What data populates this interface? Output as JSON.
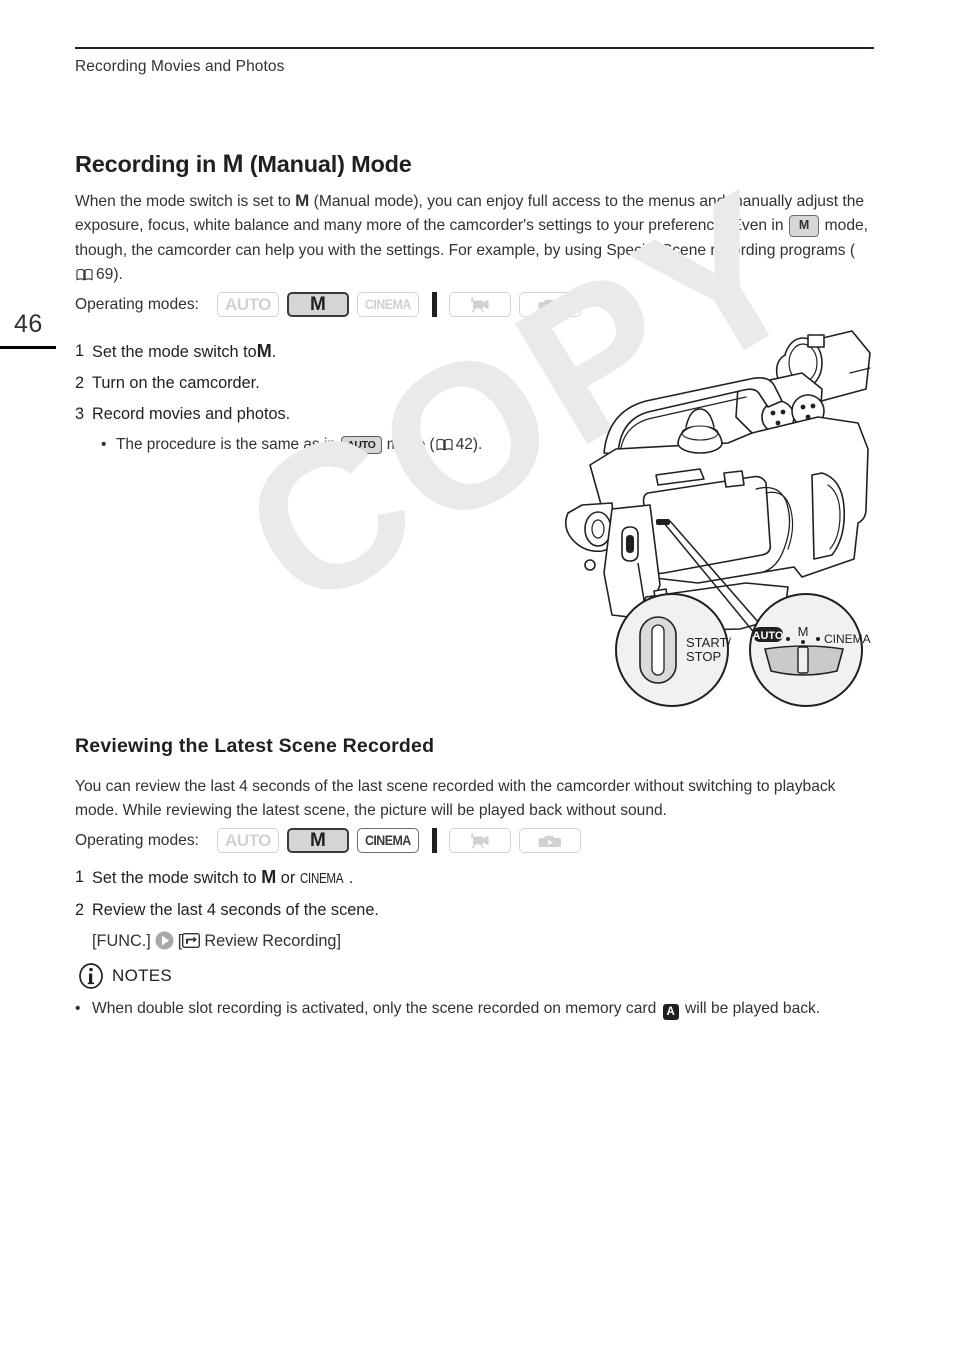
{
  "page": {
    "running_head": "Recording Movies and Photos",
    "number": "46",
    "watermark": "COPY"
  },
  "section1": {
    "title_pre": "Recording in",
    "title_mode": "M",
    "title_post": "(Manual) Mode",
    "intro_1": "When the mode switch is set to",
    "intro_mode_1": "M",
    "intro_2": "(Manual mode), you can enjoy full access to the menus and manually adjust the exposure, focus, white balance and many more of the camcorder's settings to your preference. Even in",
    "intro_chip": "M",
    "intro_3": "mode, though, the camcorder can help you with the settings. For example, by using Special Scene recording programs (",
    "intro_pageref": "69",
    "intro_4": ").",
    "opmodes_label": "Operating modes:",
    "badges": [
      {
        "name": "auto",
        "label": "AUTO",
        "state": "off"
      },
      {
        "name": "manual",
        "label": "M",
        "state": "on-fill"
      },
      {
        "name": "cinema",
        "label": "CINEMA",
        "state": "off"
      },
      {
        "name": "movie-playback",
        "label": "",
        "state": "off"
      },
      {
        "name": "photo-playback",
        "label": "",
        "state": "off"
      }
    ],
    "steps": [
      {
        "num": "1",
        "pre": "Set the mode switch to",
        "mode": "M",
        "post": "."
      },
      {
        "num": "2",
        "pre": "Turn on the camcorder.",
        "mode": "",
        "post": ""
      },
      {
        "num": "3",
        "pre": "Record movies and photos.",
        "mode": "",
        "post": ""
      }
    ],
    "bullet_pre": "The procedure is the same as in",
    "bullet_chip": "AUTO",
    "bullet_mid": "mode (",
    "bullet_pageref": "42",
    "bullet_post": ")."
  },
  "illustration": {
    "callout_start_stop": "START/\nSTOP",
    "callout_start_stop_line1": "START/",
    "callout_start_stop_line2": "STOP",
    "switch_auto": "AUTO",
    "switch_m": "M",
    "switch_cinema": "CINEMA"
  },
  "section2": {
    "title": "Reviewing the Latest Scene Recorded",
    "body": "You can review the last 4 seconds of the last scene recorded with the camcorder without switching to playback mode. While reviewing the latest scene, the picture will be played back without sound.",
    "opmodes_label": "Operating modes:",
    "badges": [
      {
        "name": "auto",
        "label": "AUTO",
        "state": "off"
      },
      {
        "name": "manual",
        "label": "M",
        "state": "on-fill"
      },
      {
        "name": "cinema",
        "label": "CINEMA",
        "state": "on-out"
      },
      {
        "name": "movie-playback",
        "label": "",
        "state": "off"
      },
      {
        "name": "photo-playback",
        "label": "",
        "state": "off"
      }
    ],
    "step1_num": "1",
    "step1_pre": "Set the mode switch to",
    "step1_mode": "M",
    "step1_or": "or",
    "step1_cinema": "CINEMA",
    "step1_post": ".",
    "step2_num": "2",
    "step2_text": "Review the last 4 seconds of the scene.",
    "step2_func": "[FUNC.]",
    "step2_menu_open": "[",
    "step2_menu_label": "Review Recording]"
  },
  "notes": {
    "label": "NOTES",
    "bullet_pre": "When double slot recording is activated, only the scene recorded on memory card",
    "card": "A",
    "bullet_post": "will be played back."
  },
  "colors": {
    "text": "#333132",
    "heading": "#231f20",
    "badge_off_border": "#d4d5d6",
    "badge_on_fill": "#d4d5d6",
    "watermark": "#e9eaea"
  }
}
